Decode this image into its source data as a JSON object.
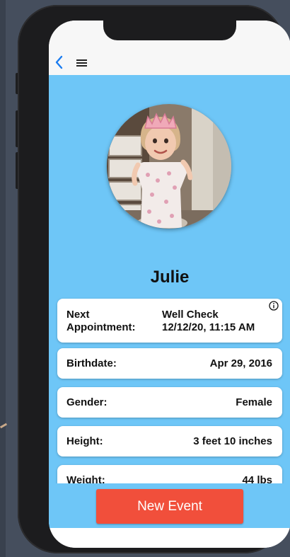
{
  "nav": {
    "back_icon": "chevron-left-icon",
    "menu_icon": "hamburger-menu-icon",
    "accent": "#1a7cf0"
  },
  "profile": {
    "photo": "child-in-tiara-photo",
    "name": "Julie"
  },
  "details": [
    {
      "label": "Next Appointment:",
      "label_line1": "Next",
      "label_line2": "Appointment:",
      "value_line1": "Well Check",
      "value_line2": "12/12/20, 11:15 AM"
    },
    {
      "label": "Birthdate:",
      "value": "Apr 29, 2016"
    },
    {
      "label": "Gender:",
      "value": "Female"
    },
    {
      "label": "Height:",
      "value": "3 feet 10 inches"
    },
    {
      "label": "Weight:",
      "value": "44 lbs"
    }
  ],
  "actions": {
    "new_event_label": "New Event",
    "new_event_color": "#f14f3b"
  },
  "colors": {
    "background": "#6ec6f7",
    "card": "#ffffff"
  }
}
